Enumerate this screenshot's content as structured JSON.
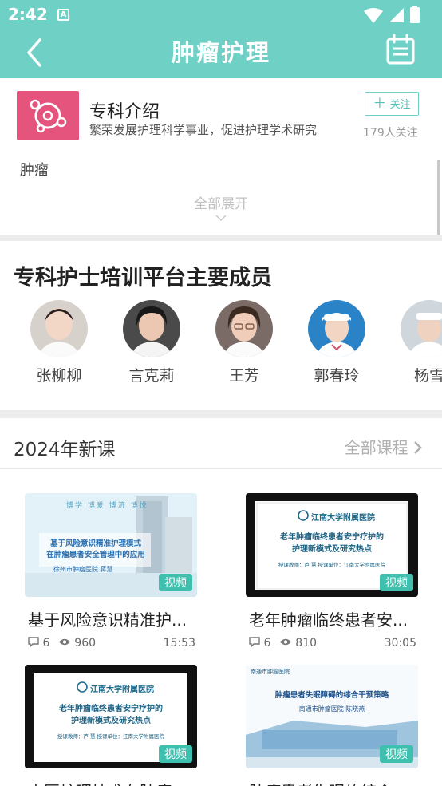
{
  "status": {
    "time": "2:42",
    "notif_glyph": "A"
  },
  "nav": {
    "title": "肿瘤护理",
    "back_icon": "back-chevron-icon",
    "calendar_icon": "calendar-icon"
  },
  "intro": {
    "title": "专科介绍",
    "subtitle": "繁荣发展护理科学事业，促进护理学术研究",
    "follow_label": "关注",
    "follow_count": "179人关注",
    "tag": "肿瘤",
    "expand_label": "全部展开"
  },
  "members": {
    "title": "专科护士培训平台主要成员",
    "items": [
      {
        "name": "张柳柳"
      },
      {
        "name": "言克莉"
      },
      {
        "name": "王芳"
      },
      {
        "name": "郭春玲"
      },
      {
        "name": "杨雪"
      }
    ]
  },
  "courses": {
    "section_title": "2024年新课",
    "all_label": "全部课程",
    "items": [
      {
        "title": "基于风险意识精准护...",
        "comments": "6",
        "views": "960",
        "duration": "15:53",
        "tag": "视频",
        "thumb_text": {
          "line1": "博学 博爱 博济 博悦",
          "line2": "基于风险意识精准护理模式",
          "line3": "在肿瘤患者安全管理中的应用",
          "line4": "徐州市肿瘤医院 蒋慧"
        }
      },
      {
        "title": "老年肿瘤临终患者安...",
        "comments": "6",
        "views": "810",
        "duration": "30:05",
        "tag": "视频",
        "thumb_text": {
          "line1": "江南大学附属医院",
          "line2": "老年肿瘤临终患者安宁疗护的",
          "line3": "护理新模式及研究热点",
          "line4": "授课教师：芦 慧    授课单位：江南大学附属医院"
        }
      },
      {
        "title": "中医护理技术在肿瘤...",
        "comments": "",
        "views": "",
        "duration": "",
        "tag": "视频",
        "thumb_text": {
          "line1": "江南大学附属医院",
          "line2": "老年肿瘤临终患者安宁疗护的",
          "line3": "护理新模式及研究热点",
          "line4": "授课教师：芦 慧    授课单位：江南大学附属医院"
        }
      },
      {
        "title": "肿瘤患者失眠的综合...",
        "comments": "",
        "views": "",
        "duration": "",
        "tag": "视频",
        "thumb_text": {
          "line1": "南通市肿瘤医院",
          "line2": "肿瘤患者失眠障碍的综合干预策略",
          "line3": "南通市肿瘤医院  陈晓燕",
          "line4": ""
        }
      }
    ]
  },
  "colors": {
    "brand": "#6fd0c6",
    "logo_bg": "#e5547d",
    "video_tag": "#3fbfae"
  }
}
